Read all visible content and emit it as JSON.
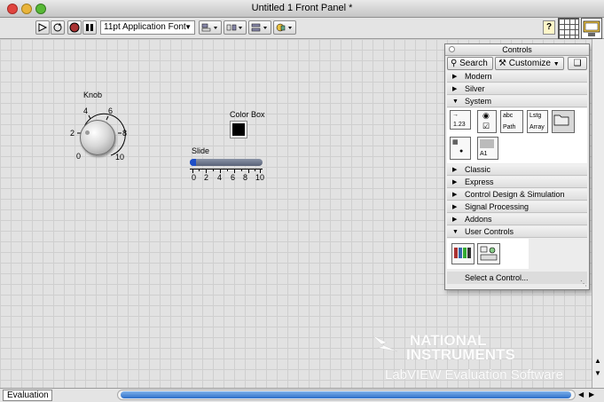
{
  "window": {
    "title": "Untitled 1 Front Panel *"
  },
  "toolbar": {
    "font_label": "11pt Application Font",
    "help_label": "?"
  },
  "front_panel": {
    "knob": {
      "label": "Knob",
      "scale": [
        "0",
        "2",
        "4",
        "6",
        "8",
        "10"
      ],
      "value": 0
    },
    "color_box": {
      "label": "Color Box",
      "color": "#000000"
    },
    "slide": {
      "label": "Slide",
      "scale": [
        "0",
        "2",
        "4",
        "6",
        "8",
        "10"
      ],
      "value": 0
    }
  },
  "palette": {
    "title": "Controls",
    "search_label": "Search",
    "customize_label": "Customize",
    "categories": [
      {
        "label": "Modern",
        "expanded": false
      },
      {
        "label": "Silver",
        "expanded": false
      },
      {
        "label": "System",
        "expanded": true
      },
      {
        "label": "Classic",
        "expanded": false
      },
      {
        "label": "Express",
        "expanded": false
      },
      {
        "label": "Control Design & Simulation",
        "expanded": false
      },
      {
        "label": "Signal Processing",
        "expanded": false
      },
      {
        "label": "Addons",
        "expanded": false
      },
      {
        "label": "User Controls",
        "expanded": true
      }
    ],
    "system_icons": {
      "numeric": "1.23",
      "string": "abc",
      "path": "Path",
      "listbox": "Lstg",
      "array": "Array",
      "decoration": "A1"
    },
    "select_control": "Select a Control..."
  },
  "statusbar": {
    "tab_label": "Evaluation"
  },
  "watermark": {
    "line1": "NATIONAL",
    "line2": "INSTRUMENTS",
    "line3": "LabVIEW Evaluation Software"
  },
  "colors": {
    "accent": "#2d6fc9",
    "slide_fill": "#1e4fc7",
    "panel_bg": "#e2e2e2"
  }
}
